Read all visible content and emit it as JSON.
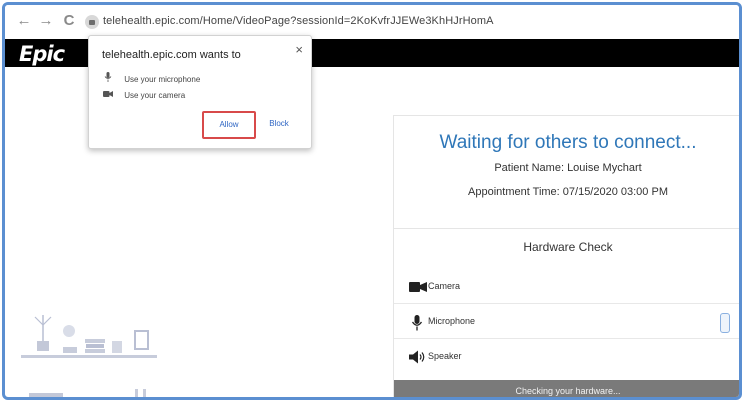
{
  "browser": {
    "url": "telehealth.epic.com/Home/VideoPage?sessionId=2KoKvfrJJEWe3KhHJrHomA",
    "back_glyph": "←",
    "forward_glyph": "→",
    "reload_glyph": "C"
  },
  "header": {
    "logo_text": "Epic"
  },
  "permission_popup": {
    "title": "telehealth.epic.com wants to",
    "close_glyph": "×",
    "items": [
      {
        "icon": "microphone-icon",
        "label": "Use your microphone"
      },
      {
        "icon": "camera-icon",
        "label": "Use your camera"
      }
    ],
    "allow_label": "Allow",
    "block_label": "Block"
  },
  "waiting": {
    "title": "Waiting for others to connect...",
    "patient_line": "Patient Name: Louise Mychart",
    "appointment_line": "Appointment Time: 07/15/2020 03:00 PM"
  },
  "hardware_check": {
    "title": "Hardware Check",
    "items": [
      {
        "icon": "camera-icon",
        "label": "Camera"
      },
      {
        "icon": "microphone-icon",
        "label": "Microphone"
      },
      {
        "icon": "speaker-icon",
        "label": "Speaker"
      }
    ],
    "status": "Checking your hardware..."
  },
  "colors": {
    "frame_border": "#5b8fd1",
    "title_blue": "#2f77b8",
    "link_blue": "#2f66c4",
    "allow_highlight": "#d84a4a",
    "footer_gray": "#7a7a7a"
  }
}
